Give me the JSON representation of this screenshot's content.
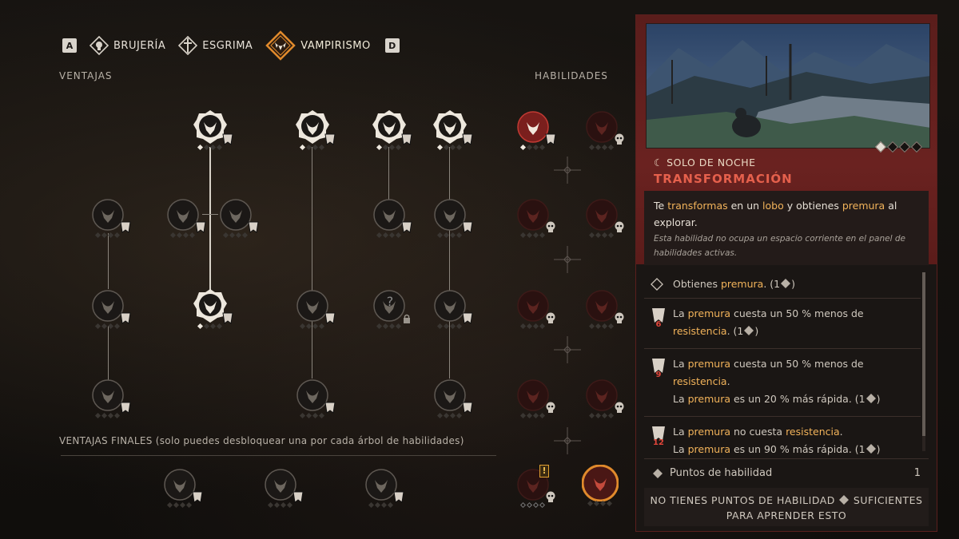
{
  "tabs": {
    "left_key": "A",
    "right_key": "D",
    "items": [
      {
        "label": "BRUJERÍA"
      },
      {
        "label": "ESGRIMA"
      },
      {
        "label": "VAMPIRISMO"
      }
    ]
  },
  "sections": {
    "ventajas": "VENTAJAS",
    "habilidades": "HABILIDADES",
    "ventajas_finales": "VENTAJAS FINALES (solo puedes desbloquear una por cada árbol de habilidades)"
  },
  "colors": {
    "accent_orange": "#e08a2c",
    "title_red": "#e5604c",
    "highlight": "#f2b35a",
    "panel_red": "#5a1d1b"
  },
  "detail": {
    "subtitle": "☾ SOLO DE NOCHE",
    "title": "TRANSFORMACIÓN",
    "desc_parts": [
      "Te ",
      "transformas",
      " en un ",
      "lobo",
      " y obtienes ",
      "premura",
      " al explorar."
    ],
    "note": "Esta habilidad no ocupa un espacio corriente en el panel de habilidades activas.",
    "items": [
      {
        "parts": [
          "Obtienes ",
          "premura",
          ".  (1",
          ")"
        ]
      },
      {
        "level": "6",
        "parts": [
          "La ",
          "premura",
          " cuesta un 50 % menos de ",
          "resistencia",
          ".  (1",
          ")"
        ]
      },
      {
        "level": "9",
        "parts": [
          "La ",
          "premura",
          " cuesta un 50 % menos de ",
          "resistencia",
          "."
        ],
        "parts2": [
          "La ",
          "premura",
          " es un 20 % más rápida.  (1",
          ")"
        ]
      },
      {
        "level": "12",
        "parts": [
          "La ",
          "premura",
          " no cuesta ",
          "resistencia",
          "."
        ],
        "parts2": [
          "La ",
          "premura",
          " es un 90 % más rápida.  (1",
          ")"
        ]
      }
    ],
    "points_label": "Puntos de habilidad",
    "points_value": "1",
    "warn_line1a": "NO TIENES PUNTOS DE HABILIDAD",
    "warn_line1b": "SUFICIENTES",
    "warn_line2": "PARA APRENDER ESTO"
  },
  "locked_node_glyph": "?",
  "alert_glyph": "!"
}
